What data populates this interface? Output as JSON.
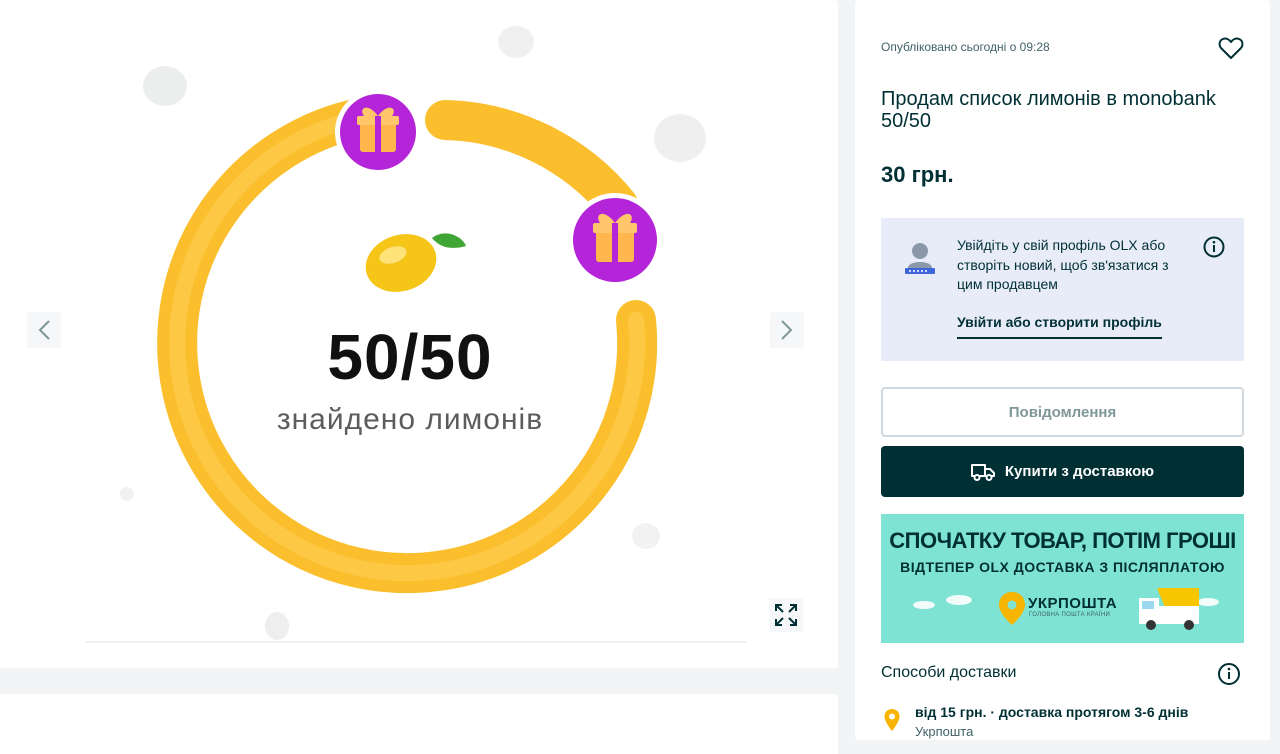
{
  "gallery": {
    "image": {
      "score": "50/50",
      "caption": "знайдено лимонів"
    },
    "prev_icon": "chevron-left-icon",
    "next_icon": "chevron-right-icon",
    "expand_icon": "expand-icon",
    "accent_colors": {
      "ring": "#ffc73a",
      "gift": "#b424d8"
    }
  },
  "listing": {
    "published": "Опубліковано сьогодні о 09:28",
    "title": "Продам список лимонів в monobank 50/50",
    "price": "30 грн."
  },
  "login_prompt": {
    "text": "Увійдіть у свій профіль OLX або створіть новий, щоб зв'язатися з цим продавцем",
    "link": "Увійти або створити профіль"
  },
  "actions": {
    "message": "Повідомлення",
    "buy_with_delivery": "Купити з доставкою"
  },
  "banner": {
    "headline": "СПОЧАТКУ ТОВАР, ПОТІМ ГРОШІ",
    "subline": "ВІДТЕПЕР OLX ДОСТАВКА З ПІСЛЯПЛАТОЮ",
    "logo": "УКРПОШТА",
    "logo_tagline": "ГОЛОВНА ПОШТА КРАЇНИ",
    "background": "#7fe3d3"
  },
  "delivery": {
    "title": "Способи доставки",
    "option": "від 15 грн. · доставка протягом 3-6 днів",
    "option_provider": "Укрпошта"
  },
  "colors": {
    "primary": "#002f34",
    "info_bg": "#e8ecf9"
  }
}
